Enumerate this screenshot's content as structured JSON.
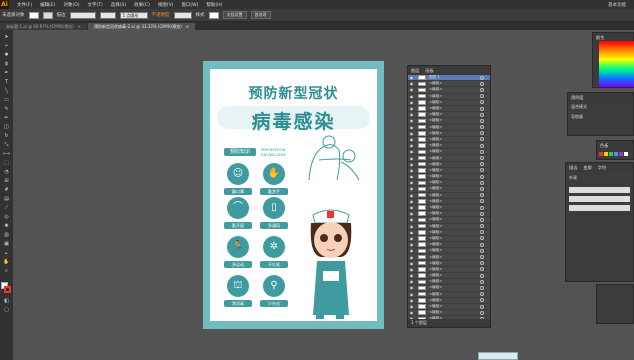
{
  "menubar": {
    "logo": "Ai",
    "items": [
      "文件(F)",
      "编辑(E)",
      "对象(O)",
      "文字(T)",
      "选择(S)",
      "效果(C)",
      "视图(V)",
      "窗口(W)",
      "帮助(H)"
    ],
    "workspace": "基本功能"
  },
  "control": {
    "label": "未选择对象",
    "stroke_label": "描边",
    "stroke_value": "",
    "style_label": "5 点圆形",
    "opacity_label": "不透明度",
    "style2": "样式",
    "doc_setup": "文档设置",
    "prefs": "首选项"
  },
  "tabs": [
    {
      "label": "未标题-1.ai @ 66.67% (CMYK/预览)",
      "close": "×"
    },
    {
      "label": "预防新型冠状病毒-2.ai @ 33.33% (CMYK/预览)",
      "close": "×"
    }
  ],
  "poster": {
    "title_line1": "预防新型冠状",
    "title_line2": "病毒感染",
    "section": "预防知识",
    "prevention_en_1": "PREVENTION",
    "prevention_en_2": "KNOWLEDGE",
    "items": [
      "戴口罩",
      "勤洗手",
      "勤开窗",
      "多通风",
      "多运动",
      "不扎堆",
      "常消毒",
      "少外出"
    ]
  },
  "layers_panel": {
    "tab1": "图层",
    "tab2": "画板",
    "group_label": "<编组>",
    "top_label": "图层 1",
    "footer": "1 个图层",
    "rows": [
      "<编组>",
      "<编组>",
      "<编组>",
      "<编组>",
      "<编组>",
      "<编组>",
      "<编组>",
      "<编组>",
      "<编组>",
      "<编组>",
      "<编组>",
      "<编组>",
      "<编组>",
      "<编组>",
      "<编组>",
      "<编组>",
      "<编组>",
      "<编组>",
      "<编组>",
      "<编组>",
      "<编组>",
      "<编组>",
      "<编组>",
      "<编组>",
      "<编组>",
      "<编组>",
      "<编组>",
      "<编组>",
      "<编组>",
      "<编组>",
      "<编组>",
      "<编组>",
      "<编组>",
      "<编组>",
      "<编组>",
      "<编组>",
      "<编组>",
      "<编组>",
      "<编组>"
    ]
  },
  "right": {
    "transparency": "透明度",
    "blend": "混合模式",
    "navigator": "导航器",
    "color": "颜色",
    "swatches": "色板",
    "transform": "变换",
    "stroke": "描边",
    "appearance": "外观",
    "type": "字符"
  },
  "colors": {
    "accent": "#3f9ba0",
    "bg": "#71bcc1"
  }
}
